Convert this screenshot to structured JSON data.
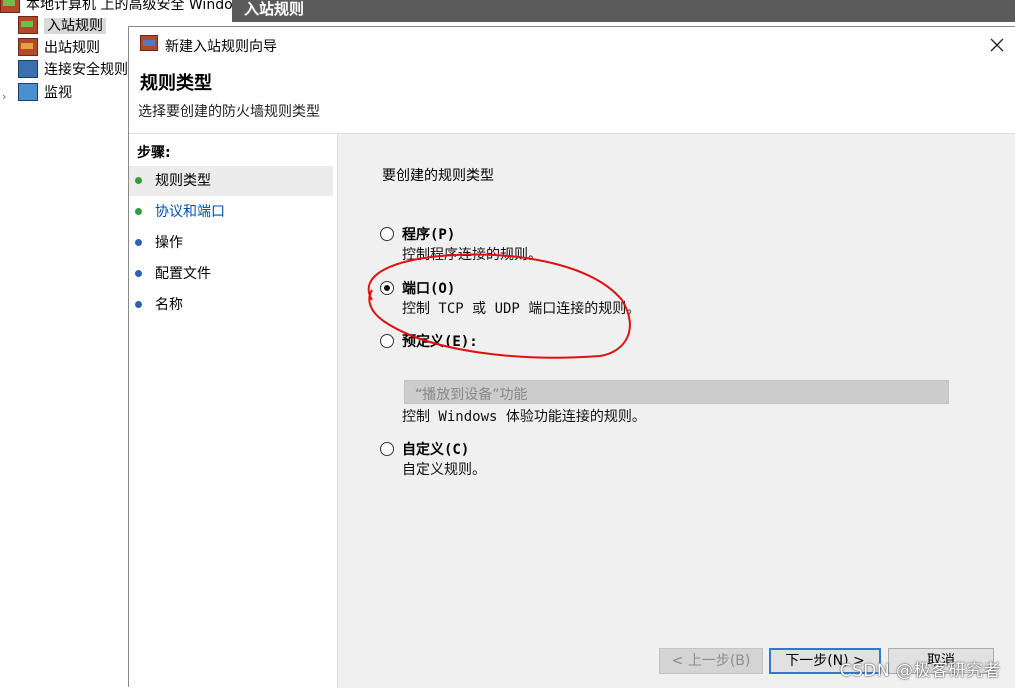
{
  "background": {
    "tree": {
      "root": "本地计算机 上的高级安全 Windows",
      "items": [
        "入站规则",
        "出站规则",
        "连接安全规则",
        "监视"
      ]
    },
    "header": "入站规则"
  },
  "dialog": {
    "title": "新建入站规则向导",
    "heading": "规则类型",
    "subheading": "选择要创建的防火墙规则类型",
    "steps_title": "步骤:",
    "steps": [
      "规则类型",
      "协议和端口",
      "操作",
      "配置文件",
      "名称"
    ],
    "content_title": "要创建的规则类型",
    "options": [
      {
        "label": "程序(P)",
        "desc": "控制程序连接的规则。",
        "checked": false
      },
      {
        "label": "端口(O)",
        "desc": "控制 TCP 或 UDP 端口连接的规则。",
        "checked": true
      },
      {
        "label": "预定义(E):",
        "desc": "控制 Windows 体验功能连接的规则。",
        "checked": false
      },
      {
        "label": "自定义(C)",
        "desc": "自定义规则。",
        "checked": false
      }
    ],
    "predefined_select": "“播放到设备”功能",
    "buttons": {
      "back": "< 上一步(B)",
      "next": "下一步(N) >",
      "cancel": "取消"
    }
  },
  "watermark": "CSDN @极客研究者",
  "colors": {
    "step_dot_done": "#3a9a3a",
    "step_dot_todo": "#2f5fb8",
    "step_link": "#0050b0",
    "annotation": "#e01010"
  }
}
